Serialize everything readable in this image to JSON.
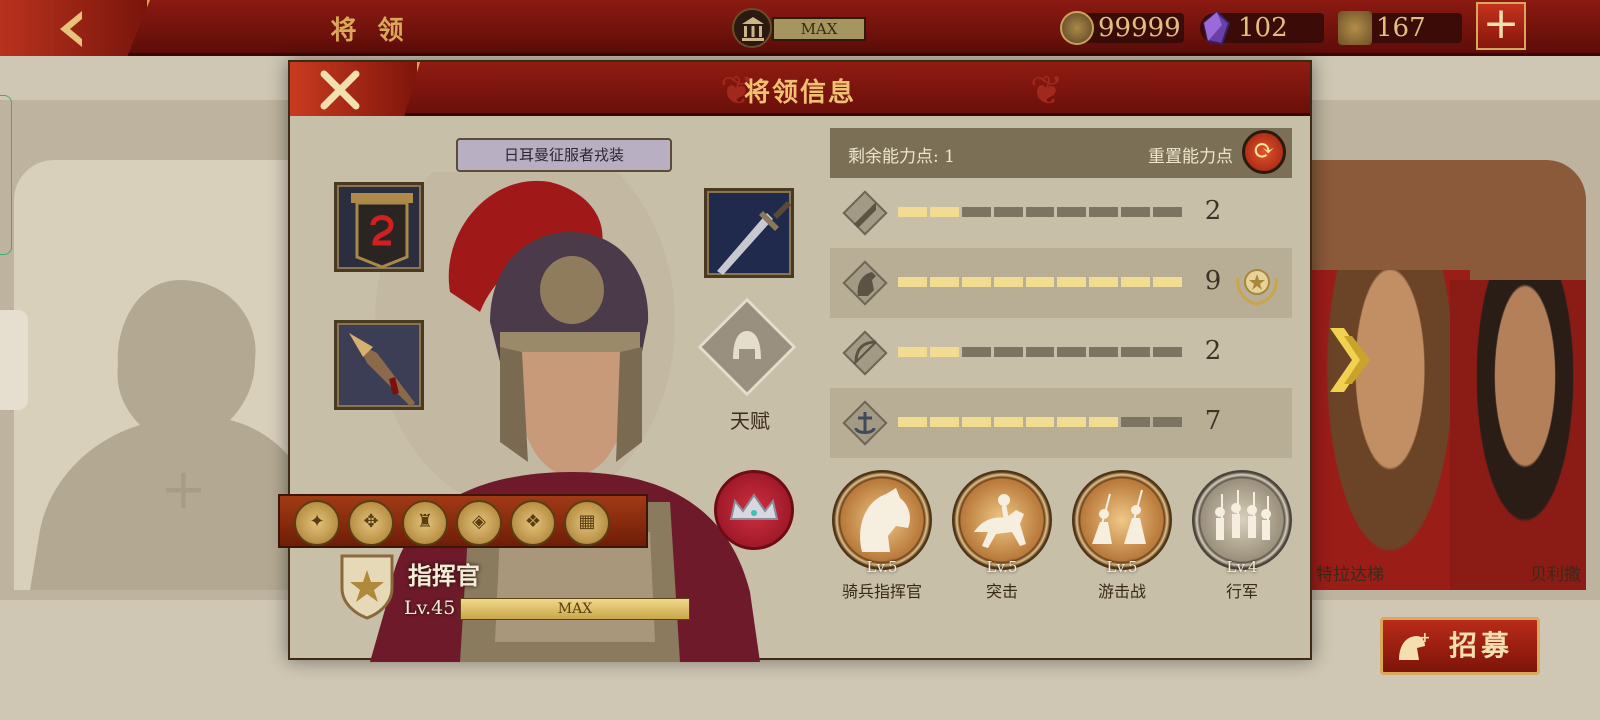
{
  "header": {
    "title": "将 领",
    "building_level": "MAX",
    "resources": {
      "gold": "99999",
      "gems": "102",
      "spqr": "167"
    }
  },
  "dialog": {
    "title": "将领信息",
    "costume_name": "日耳曼征服者戎装",
    "talent_label": "天赋",
    "general": {
      "rank": "指挥官",
      "level": "Lv.45",
      "level_bar_text": "MAX"
    },
    "stats": {
      "remaining_points_label": "剩余能力点: 1",
      "reset_label": "重置能力点",
      "rows": [
        {
          "icon": "sword-icon",
          "value": "2",
          "filled": 2,
          "max": 9
        },
        {
          "icon": "horse-icon",
          "value": "9",
          "filled": 9,
          "max": 9
        },
        {
          "icon": "bow-icon",
          "value": "2",
          "filled": 2,
          "max": 9
        },
        {
          "icon": "anchor-icon",
          "value": "7",
          "filled": 7,
          "max": 9
        }
      ]
    },
    "skills": [
      {
        "level": "Lv.5",
        "name": "骑兵指挥官"
      },
      {
        "level": "Lv.5",
        "name": "突击"
      },
      {
        "level": "Lv.5",
        "name": "游击战"
      },
      {
        "level": "Lv.4",
        "name": "行军"
      }
    ]
  },
  "background": {
    "right_card_names": [
      "特拉达梯",
      "贝利撒"
    ],
    "recruit_label": "招募"
  },
  "colors": {
    "header_red": "#8b1a12",
    "gold_text": "#f0c170",
    "stat_fill": "#f2dc92",
    "stat_empty": "#7d7361"
  }
}
